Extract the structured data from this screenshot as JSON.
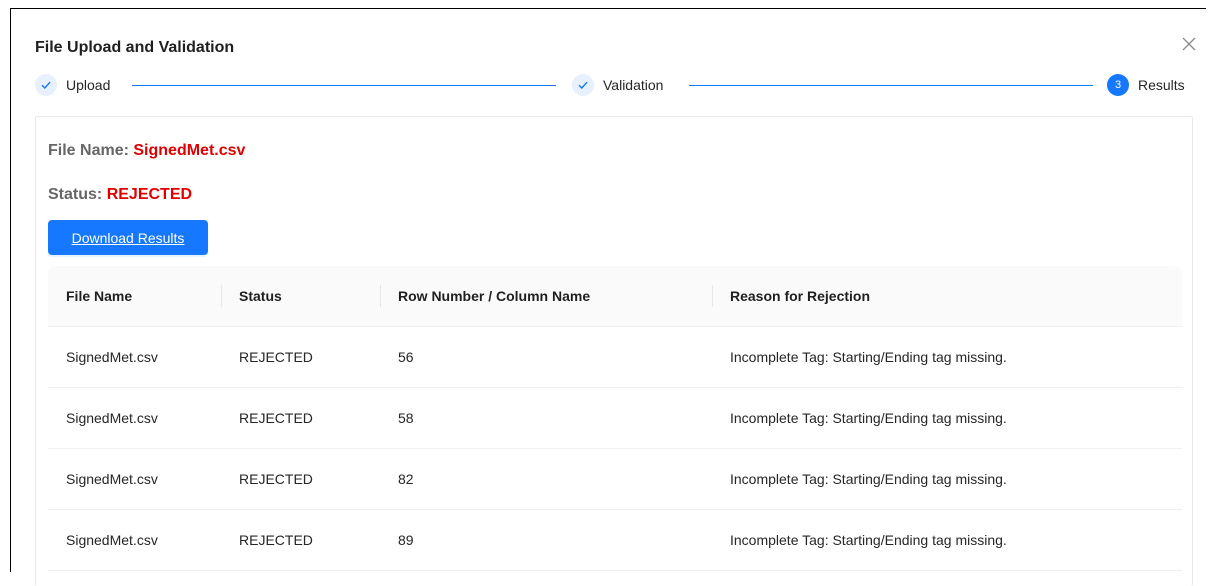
{
  "modal": {
    "title": "File Upload and Validation"
  },
  "stepper": {
    "steps": [
      {
        "label": "Upload",
        "state": "done"
      },
      {
        "label": "Validation",
        "state": "done"
      },
      {
        "label": "Results",
        "state": "active",
        "number": "3"
      }
    ],
    "accent_color": "#1677ff"
  },
  "summary": {
    "file_name_label": "File Name:",
    "file_name_value": "SignedMet.csv",
    "status_label": "Status:",
    "status_value": "REJECTED",
    "value_color": "#e00000"
  },
  "actions": {
    "download_label": "Download Results"
  },
  "table": {
    "columns": [
      "File Name",
      "Status",
      "Row Number / Column Name",
      "Reason for Rejection"
    ],
    "rows": [
      [
        "SignedMet.csv",
        "REJECTED",
        "56",
        "Incomplete Tag: Starting/Ending tag missing."
      ],
      [
        "SignedMet.csv",
        "REJECTED",
        "58",
        "Incomplete Tag: Starting/Ending tag missing."
      ],
      [
        "SignedMet.csv",
        "REJECTED",
        "82",
        "Incomplete Tag: Starting/Ending tag missing."
      ],
      [
        "SignedMet.csv",
        "REJECTED",
        "89",
        "Incomplete Tag: Starting/Ending tag missing."
      ]
    ]
  },
  "icons": {
    "close": "close-icon",
    "check": "check-icon"
  }
}
